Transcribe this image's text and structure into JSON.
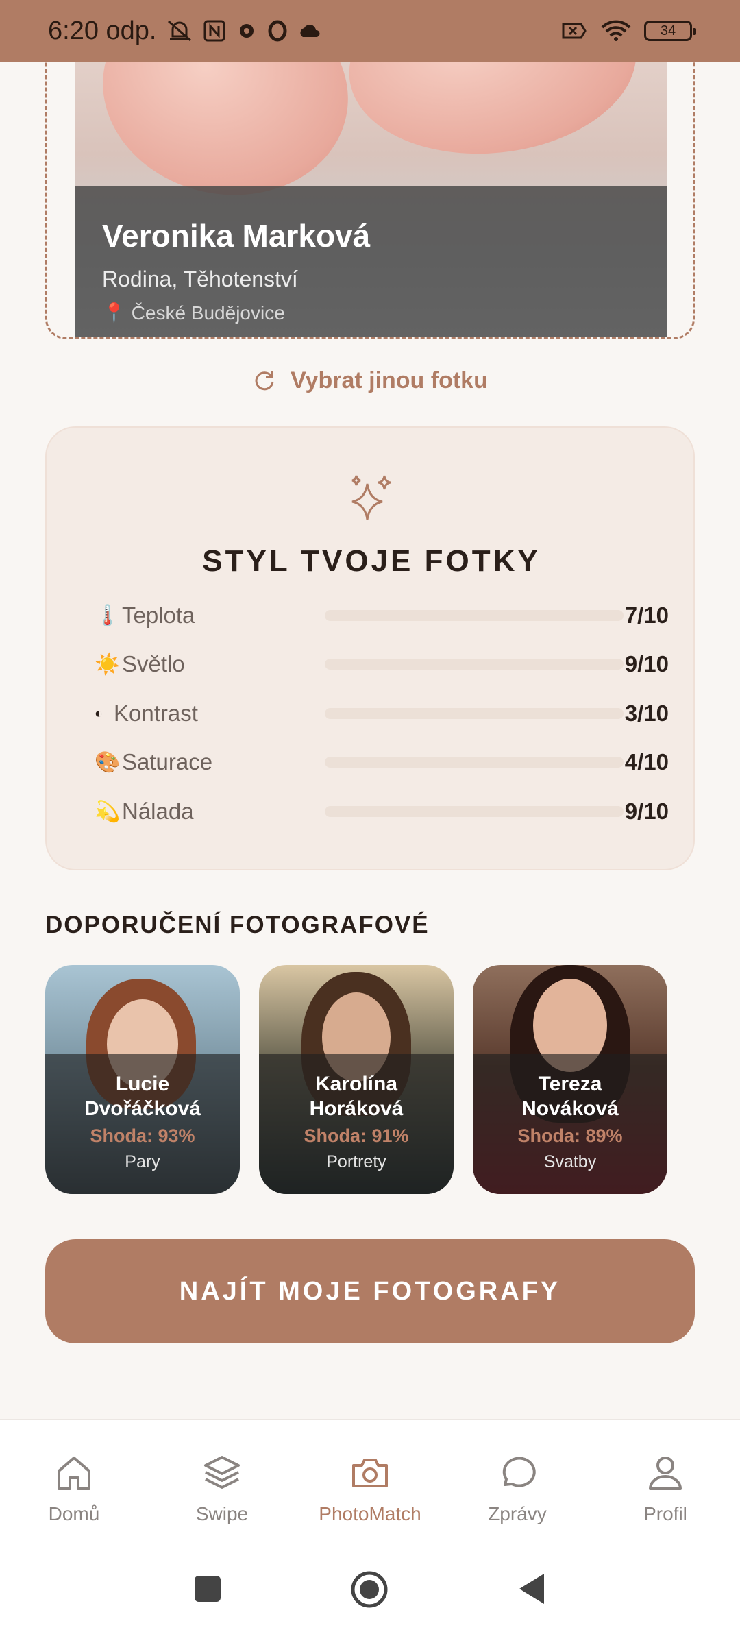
{
  "status": {
    "time": "6:20 odp.",
    "battery": "34"
  },
  "photo": {
    "name": "Veronika Marková",
    "tags": "Rodina, Těhotenství",
    "location": "České Budějovice"
  },
  "change_photo_label": "Vybrat jinou fotku",
  "style": {
    "title": "STYL TVOJE FOTKY",
    "metrics": [
      {
        "emoji": "🌡️",
        "label": "Teplota",
        "value": 7,
        "score": "7/10"
      },
      {
        "emoji": "☀️",
        "label": "Světlo",
        "value": 9,
        "score": "9/10"
      },
      {
        "emoji": "◐",
        "label": "Kontrast",
        "value": 3,
        "score": "3/10"
      },
      {
        "emoji": "🎨",
        "label": "Saturace",
        "value": 4,
        "score": "4/10"
      },
      {
        "emoji": "💫",
        "label": "Nálada",
        "value": 9,
        "score": "9/10"
      }
    ]
  },
  "recommended": {
    "title": "DOPORUČENÍ FOTOGRAFOVÉ",
    "photographers": [
      {
        "first": "Lucie",
        "last": "Dvořáčková",
        "match": "Shoda: 93%",
        "category": "Pary"
      },
      {
        "first": "Karolína",
        "last": "Horáková",
        "match": "Shoda: 91%",
        "category": "Portrety"
      },
      {
        "first": "Tereza",
        "last": "Nováková",
        "match": "Shoda: 89%",
        "category": "Svatby"
      }
    ]
  },
  "cta_label": "NAJÍT MOJE FOTOGRAFY",
  "nav": {
    "items": [
      {
        "label": "Domů",
        "icon": "home-icon"
      },
      {
        "label": "Swipe",
        "icon": "layers-icon"
      },
      {
        "label": "PhotoMatch",
        "icon": "camera-icon"
      },
      {
        "label": "Zprávy",
        "icon": "chat-icon"
      },
      {
        "label": "Profil",
        "icon": "user-icon"
      }
    ],
    "active": "PhotoMatch"
  },
  "colors": {
    "accent": "#b07c64",
    "background": "#f9f6f3",
    "card": "#f4ebe5"
  }
}
